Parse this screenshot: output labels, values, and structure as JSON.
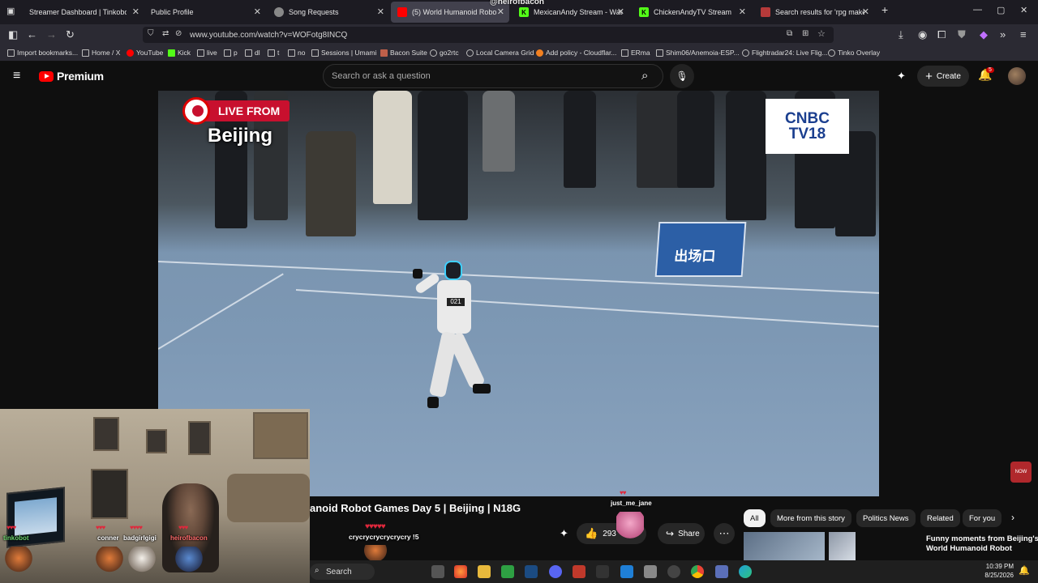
{
  "browser": {
    "tabs": [
      {
        "title": "Streamer Dashboard | Tinkobot",
        "icon": "page-icon"
      },
      {
        "title": "Public Profile",
        "icon": "page-icon"
      },
      {
        "title": "Song Requests",
        "icon": "gear-icon"
      },
      {
        "title": "(5) World Humanoid Robot",
        "icon": "youtube-icon",
        "active": true
      },
      {
        "title": "MexicanAndy Stream - Watch L",
        "icon": "kick-icon"
      },
      {
        "title": "ChickenAndyTV Stream - W",
        "icon": "kick-icon"
      },
      {
        "title": "Search results for 'rpg maker' -",
        "icon": "page-icon"
      }
    ],
    "url": "www.youtube.com/watch?v=WOFotg8INCQ",
    "bookmarks": [
      "Import bookmarks...",
      "Home / X",
      "YouTube",
      "Kick",
      "live",
      "p",
      "dl",
      "t",
      "no",
      "Sessions | Umami",
      "Bacon Suite",
      "go2rtc",
      "Local Camera Grid",
      "Add policy - Cloudflar...",
      "ERma",
      "Shim06/Anemoia-ESP...",
      "Flightradar24: Live Flig...",
      "Tinko Overlay"
    ]
  },
  "youtube": {
    "logo_text": "Premium",
    "search_placeholder": "Search or ask a question",
    "create_label": "Create",
    "notification_count": "5",
    "video": {
      "live_label": "LIVE FROM",
      "city": "Beijing",
      "channel_logo_top": "CNBC",
      "channel_logo_bottom": "TV18",
      "sign_text": "出场口",
      "robot_number": "021"
    },
    "title": "anoid Robot Games Day 5 | Beijing | N18G",
    "likes": "293",
    "share_label": "Share",
    "chips": [
      "All",
      "More from this story",
      "Politics News",
      "Related",
      "For you"
    ],
    "related_title": "Funny moments from Beijing's World Humanoid Robot"
  },
  "overlay": {
    "top_watermark": "@heirofbacon",
    "chatters": [
      {
        "name": "tinkobot",
        "color": "#6dd36d"
      },
      {
        "name": "conner",
        "color": "#ffffff"
      },
      {
        "name": "badgirlgigi",
        "color": "#ffffff"
      },
      {
        "name": "heirofbacon",
        "color": "#ff6b6b"
      }
    ],
    "chat_message_user": "just_me_jane",
    "chat_message_text": "crycrycrycrycrycry !5",
    "now_badge": "NOW"
  },
  "taskbar": {
    "search_label": "Search",
    "time": "10:39 PM",
    "date": "8/25/2026"
  },
  "colors": {
    "youtube_red": "#ff0000",
    "cnbc_blue": "#1b3f8f",
    "live_red": "#c8102e"
  }
}
